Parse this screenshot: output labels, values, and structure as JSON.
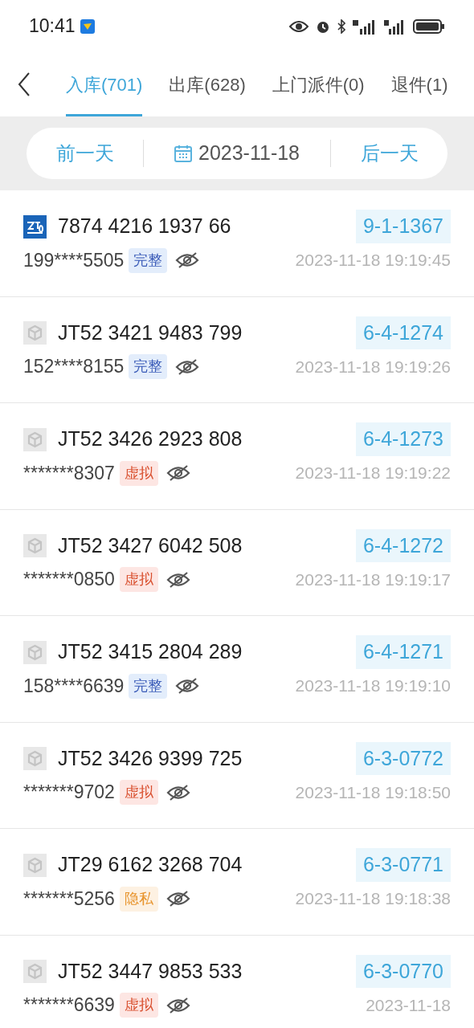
{
  "status_bar": {
    "time": "10:41"
  },
  "tabs": [
    {
      "label": "入库(701)",
      "selected": true
    },
    {
      "label": "出库(628)",
      "selected": false
    },
    {
      "label": "上门派件(0)",
      "selected": false
    },
    {
      "label": "退件(1)",
      "selected": false
    }
  ],
  "date_bar": {
    "prev": "前一天",
    "date": "2023-11-18",
    "next": "后一天"
  },
  "rows": [
    {
      "kind": "zto",
      "tracking": "7874 4216 1937 66",
      "code": "9-1-1367",
      "phone": "199****5505",
      "tag": {
        "kind": "complete",
        "label": "完整"
      },
      "time": "2023-11-18 19:19:45"
    },
    {
      "kind": "generic",
      "tracking": "JT52 3421 9483 799",
      "code": "6-4-1274",
      "phone": "152****8155",
      "tag": {
        "kind": "complete",
        "label": "完整"
      },
      "time": "2023-11-18 19:19:26"
    },
    {
      "kind": "generic",
      "tracking": "JT52 3426 2923 808",
      "code": "6-4-1273",
      "phone": "*******8307",
      "tag": {
        "kind": "virtual",
        "label": "虚拟"
      },
      "time": "2023-11-18 19:19:22"
    },
    {
      "kind": "generic",
      "tracking": "JT52 3427 6042 508",
      "code": "6-4-1272",
      "phone": "*******0850",
      "tag": {
        "kind": "virtual",
        "label": "虚拟"
      },
      "time": "2023-11-18 19:19:17"
    },
    {
      "kind": "generic",
      "tracking": "JT52 3415 2804 289",
      "code": "6-4-1271",
      "phone": "158****6639",
      "tag": {
        "kind": "complete",
        "label": "完整"
      },
      "time": "2023-11-18 19:19:10"
    },
    {
      "kind": "generic",
      "tracking": "JT52 3426 9399 725",
      "code": "6-3-0772",
      "phone": "*******9702",
      "tag": {
        "kind": "virtual",
        "label": "虚拟"
      },
      "time": "2023-11-18 19:18:50"
    },
    {
      "kind": "generic",
      "tracking": "JT29 6162 3268 704",
      "code": "6-3-0771",
      "phone": "*******5256",
      "tag": {
        "kind": "private",
        "label": "隐私"
      },
      "time": "2023-11-18 19:18:38"
    },
    {
      "kind": "generic",
      "tracking": "JT52 3447 9853 533",
      "code": "6-3-0770",
      "phone": "*******6639",
      "tag": {
        "kind": "virtual",
        "label": "虚拟"
      },
      "time": "2023-11-18"
    }
  ]
}
